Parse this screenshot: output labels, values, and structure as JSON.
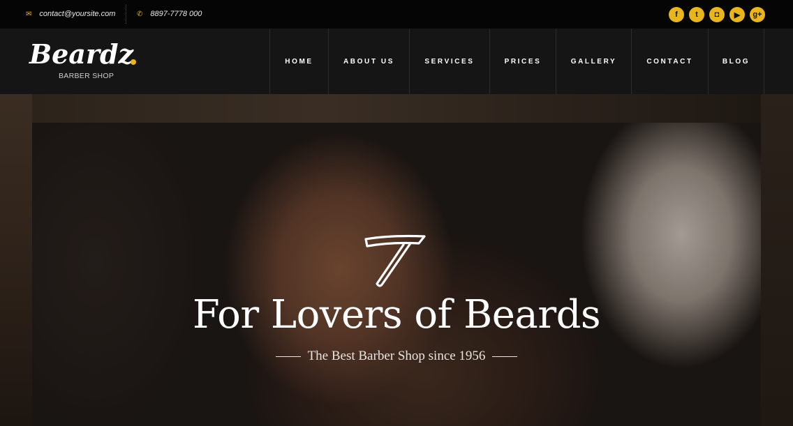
{
  "topbar": {
    "email": "contact@yoursite.com",
    "phone": "8897-7778 000",
    "socials": [
      {
        "icon": "facebook-icon",
        "glyph": "f"
      },
      {
        "icon": "twitter-icon",
        "glyph": "t"
      },
      {
        "icon": "instagram-icon",
        "glyph": "◘"
      },
      {
        "icon": "youtube-icon",
        "glyph": "▶"
      },
      {
        "icon": "google-plus-icon",
        "glyph": "g+"
      }
    ]
  },
  "logo": {
    "name": "Beardz",
    "tagline": "BARBER SHOP"
  },
  "nav": {
    "items": [
      "HOME",
      "ABOUT US",
      "SERVICES",
      "PRICES",
      "GALLERY",
      "CONTACT",
      "BLOG"
    ]
  },
  "hero": {
    "title": "For Lovers of Beards",
    "subtitle": "The Best Barber Shop since 1956"
  },
  "colors": {
    "accent": "#e9b51c",
    "topbar_bg": "#050505",
    "header_bg": "#151515"
  }
}
